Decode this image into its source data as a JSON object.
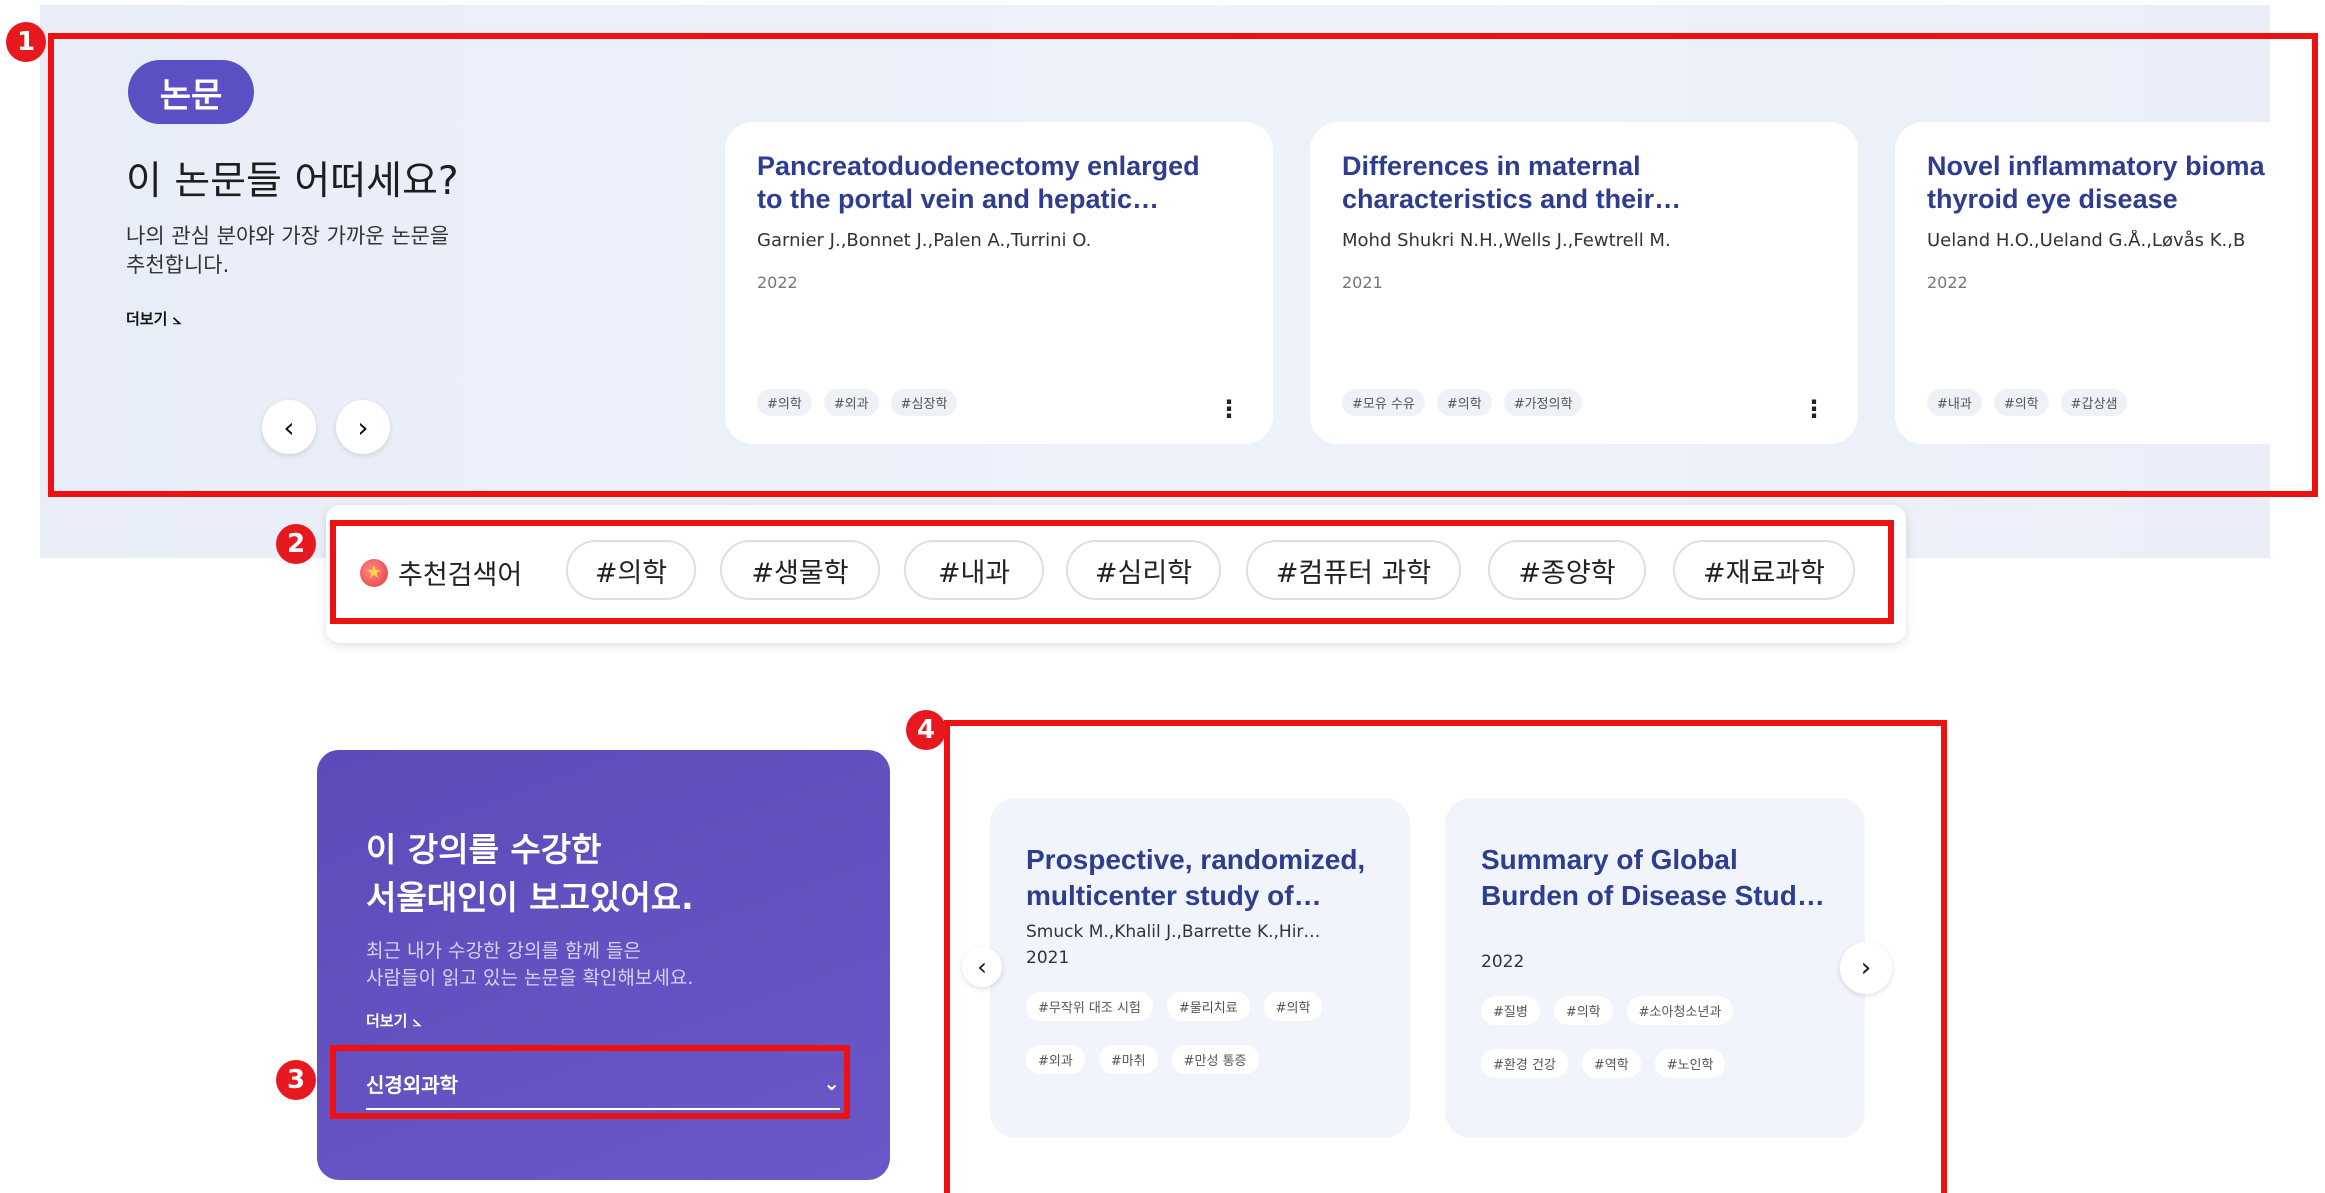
{
  "markers": [
    "1",
    "2",
    "3",
    "4"
  ],
  "papers_section": {
    "badge": "논문",
    "title": "이 논문들 어떠세요?",
    "description_line1": "나의 관심 분야와 가장 가까운 논문을",
    "description_line2": "추천합니다.",
    "more_label": "더보기",
    "prev_icon": "‹",
    "next_icon": "›",
    "cards": [
      {
        "title_line1": "Pancreatoduodenectomy enlarged",
        "title_line2": "to the portal vein and hepatic…",
        "authors": "Garnier J.,Bonnet J.,Palen A.,Turrini O.",
        "year": "2022",
        "tags": [
          "#의학",
          "#외과",
          "#심장학"
        ]
      },
      {
        "title_line1": "Differences in maternal",
        "title_line2": "characteristics and their…",
        "authors": "Mohd Shukri N.H.,Wells J.,Fewtrell M.",
        "year": "2021",
        "tags": [
          "#모유 수유",
          "#의학",
          "#가정의학"
        ]
      },
      {
        "title_line1": "Novel inflammatory bioma",
        "title_line2": "thyroid eye disease",
        "authors": "Ueland H.O.,Ueland G.Å.,Løvås K.,B",
        "year": "2022",
        "tags": [
          "#내과",
          "#의학",
          "#갑상샘"
        ]
      }
    ]
  },
  "search_section": {
    "label": "추천검색어",
    "keywords": [
      "#의학",
      "#생물학",
      "#내과",
      "#심리학",
      "#컴퓨터 과학",
      "#종양학",
      "#재료과학"
    ]
  },
  "lecture_section": {
    "title_line1": "이 강의를 수강한",
    "title_line2": "서울대인이 보고있어요.",
    "description_line1": "최근 내가 수강한 강의를 함께 들은",
    "description_line2": "사람들이 읽고 있는 논문을 확인해보세요.",
    "more_label": "더보기",
    "select_value": "신경외과학"
  },
  "recommend_section": {
    "cards": [
      {
        "title_line1": "Prospective, randomized,",
        "title_line2": "multicenter study of…",
        "authors": "Smuck M.,Khalil J.,Barrette K.,Hir…",
        "year": "2021",
        "tags_row1": [
          "#무작위 대조 시험",
          "#물리치료",
          "#의학"
        ],
        "tags_row2": [
          "#외과",
          "#마취",
          "#만성 통증"
        ]
      },
      {
        "title_line1": "Summary of Global",
        "title_line2": "Burden of Disease Study…",
        "authors": "",
        "year": "2022",
        "tags_row1": [
          "#질병",
          "#의학",
          "#소아청소년과"
        ],
        "tags_row2": [
          "#환경 건강",
          "#역학",
          "#노인학"
        ]
      }
    ]
  },
  "colors": {
    "accent_purple": "#5b4fc4",
    "title_blue": "#2e3d8f",
    "annotation_red": "#ee1111"
  }
}
